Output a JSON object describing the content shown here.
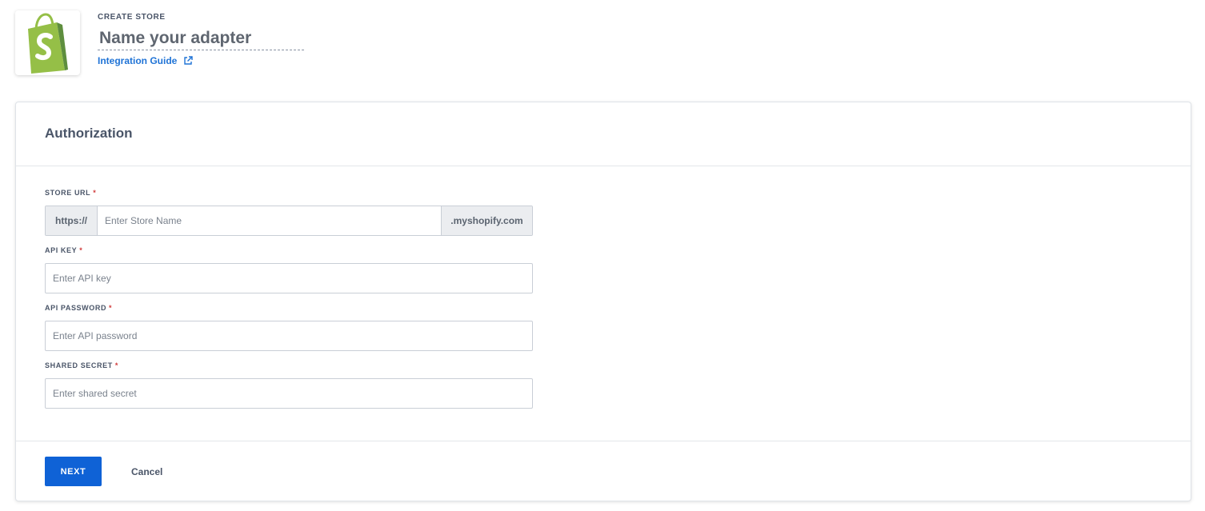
{
  "header": {
    "logo_icon": "shopify-bag-icon",
    "kicker": "CREATE STORE",
    "name_placeholder": "Name your adapter",
    "name_value": "",
    "guide_link": "Integration Guide",
    "guide_icon": "external-link-icon"
  },
  "card": {
    "title": "Authorization",
    "fields": {
      "store_url": {
        "label": "STORE URL",
        "required_mark": "*",
        "prefix": "https://",
        "placeholder": "Enter Store Name",
        "suffix": ".myshopify.com",
        "value": ""
      },
      "api_key": {
        "label": "API KEY",
        "required_mark": "*",
        "placeholder": "Enter API key",
        "value": ""
      },
      "api_password": {
        "label": "API PASSWORD",
        "required_mark": "*",
        "placeholder": "Enter API password",
        "value": ""
      },
      "shared_secret": {
        "label": "SHARED SECRET",
        "required_mark": "*",
        "placeholder": "Enter shared secret",
        "value": ""
      }
    },
    "footer": {
      "next_label": "NEXT",
      "cancel_label": "Cancel"
    }
  },
  "colors": {
    "primary": "#0f62d6",
    "link": "#1f73d6",
    "required": "#d13b3b",
    "shopify_green": "#95bf47"
  }
}
